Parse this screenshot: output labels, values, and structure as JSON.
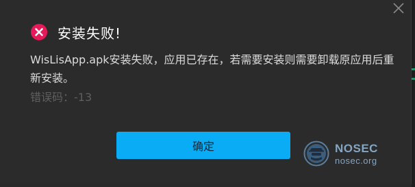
{
  "dialog": {
    "title": "安装失败!",
    "message": "WisLisApp.apk安装失败，应用已存在，若需要安装则需要卸载原应用后重新安装。",
    "error_code": "错误码：-13",
    "confirm_label": "确定",
    "close_icon": "close-icon",
    "status_icon": "error-icon",
    "accent_color": "#0aadf5",
    "error_color": "#e8195a"
  },
  "watermark": {
    "name": "NOSEC",
    "url": "nosec.org"
  }
}
